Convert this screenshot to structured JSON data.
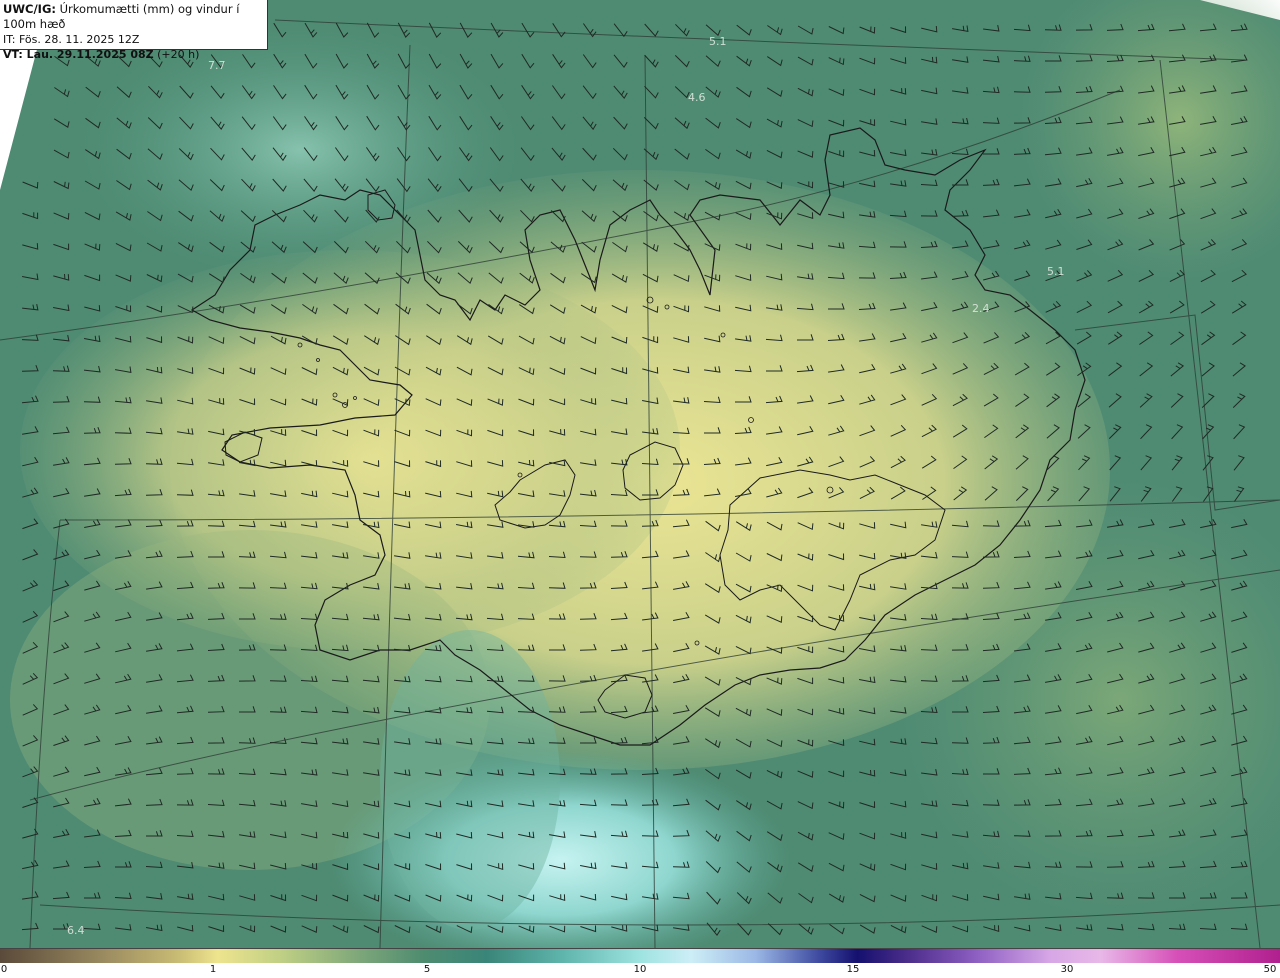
{
  "header": {
    "model_label": "UWC/IG:",
    "title": "Úrkomumætti (mm) og vindur í 100m hæð",
    "init_time": "IT: Fös. 28. 11. 2025 12Z",
    "valid_label": "VT: Lau. 29.11.2025 08Z",
    "valid_offset": "(+20 h)"
  },
  "map_labels": [
    {
      "id": "label-7-7",
      "text": "7.7"
    },
    {
      "id": "label-5-1-top",
      "text": "5.1"
    },
    {
      "id": "label-4-6",
      "text": "4.6"
    },
    {
      "id": "label-5-1-east",
      "text": "5.1"
    },
    {
      "id": "label-2-4",
      "text": "2.4"
    },
    {
      "id": "label-6-4",
      "text": "6.4"
    }
  ],
  "colorbar": {
    "ticks": [
      "0",
      "1",
      "5",
      "10",
      "15",
      "30",
      "50"
    ],
    "colors": {
      "low": "#5a4a3a",
      "one": "#eee48e",
      "five": "#4f8c70",
      "ten": "#9ee3e0",
      "fifteen": "#15106e",
      "thirty": "#e8b8e8",
      "fifty": "#b0208e"
    }
  },
  "map_colors": {
    "ocean_dark": "#3f7d6c",
    "ocean_mid": "#5a9a7c",
    "land_light": "#e4e08a",
    "south_light": "#b4ecea",
    "coastline": "#1a1a1a"
  }
}
